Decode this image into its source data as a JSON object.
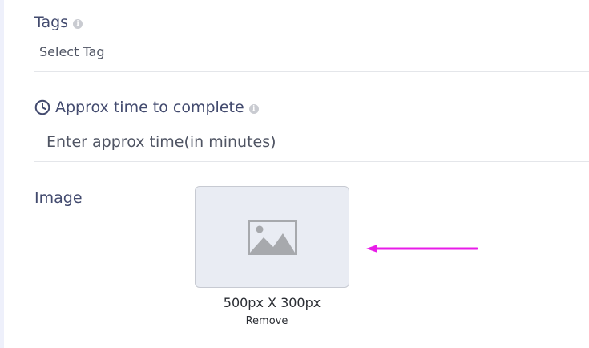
{
  "tags": {
    "label": "Tags",
    "info_icon": "i",
    "placeholder": "Select Tag"
  },
  "approx_time": {
    "label": "Approx time to complete",
    "info_icon": "i",
    "placeholder": "Enter approx time(in minutes)"
  },
  "image": {
    "label": "Image",
    "size_hint": "500px X 300px",
    "remove_label": "Remove"
  },
  "colors": {
    "label": "#424a6e",
    "annotation_arrow": "#e81ce8",
    "placeholder_box": "#e9ecf3"
  },
  "icons": [
    "info-icon",
    "clock-icon",
    "image-placeholder-icon",
    "arrow-left-icon"
  ]
}
